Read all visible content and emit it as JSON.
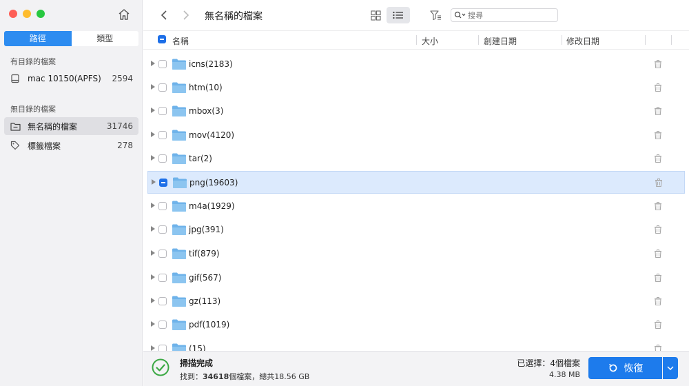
{
  "sidebar": {
    "tabs": {
      "path": "路徑",
      "type": "類型"
    },
    "section1_title": "有目錄的檔案",
    "drive": {
      "label": "mac 10150(APFS)",
      "count": "2594"
    },
    "section2_title": "無目錄的檔案",
    "items": [
      {
        "label": "無名稱的檔案",
        "count": "31746"
      },
      {
        "label": "標籤檔案",
        "count": "278"
      }
    ]
  },
  "topbar": {
    "title": "無名稱的檔案",
    "search_placeholder": "搜尋"
  },
  "table": {
    "headers": {
      "name": "名稱",
      "size": "大小",
      "created": "創建日期",
      "modified": "修改日期"
    },
    "rows": [
      {
        "name": "icns(2183)"
      },
      {
        "name": "htm(10)"
      },
      {
        "name": "mbox(3)"
      },
      {
        "name": "mov(4120)"
      },
      {
        "name": "tar(2)"
      },
      {
        "name": "png(19603)"
      },
      {
        "name": "m4a(1929)"
      },
      {
        "name": "jpg(391)"
      },
      {
        "name": "tif(879)"
      },
      {
        "name": "gif(567)"
      },
      {
        "name": "gz(113)"
      },
      {
        "name": "pdf(1019)"
      },
      {
        "name": "(15)"
      }
    ]
  },
  "status": {
    "title": "掃描完成",
    "found_prefix": "找到：",
    "found_count": "34618",
    "found_suffix": "個檔案，總共18.56 GB",
    "selected": "已選擇：4個檔案",
    "selected_size": "4.38 MB",
    "recover_label": "恢復"
  },
  "colors": {
    "accent": "#1d7bec",
    "folder": "#6fb3ea",
    "selected_row": "#dceafd",
    "success": "#3aa843"
  }
}
